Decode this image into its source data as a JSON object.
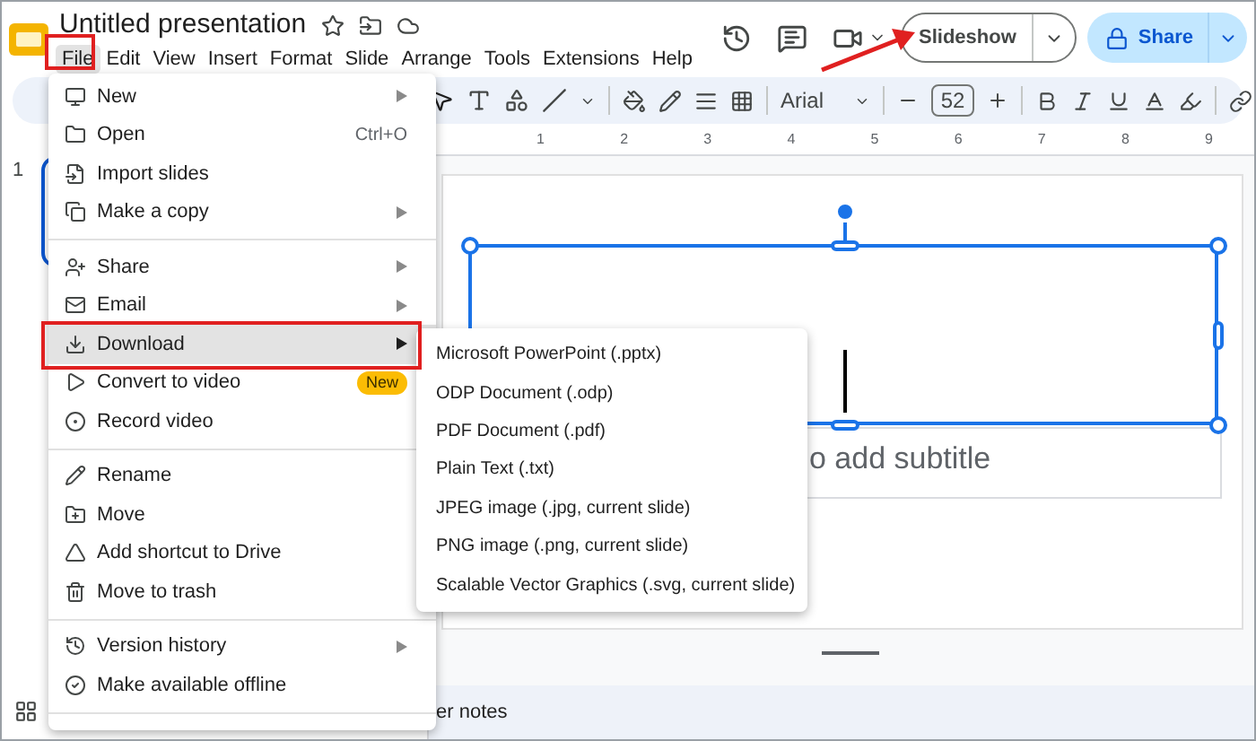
{
  "presentation": {
    "title": "Untitled presentation"
  },
  "menu_bar": [
    {
      "label": "File",
      "selected": true
    },
    {
      "label": "Edit",
      "selected": false
    },
    {
      "label": "View",
      "selected": false
    },
    {
      "label": "Insert",
      "selected": false
    },
    {
      "label": "Format",
      "selected": false
    },
    {
      "label": "Slide",
      "selected": false
    },
    {
      "label": "Arrange",
      "selected": false
    },
    {
      "label": "Tools",
      "selected": false
    },
    {
      "label": "Extensions",
      "selected": false
    },
    {
      "label": "Help",
      "selected": false
    }
  ],
  "header": {
    "slideshow_button": "Slideshow",
    "share_button": "Share"
  },
  "toolbar": {
    "font": "Arial",
    "font_size": "52"
  },
  "ruler": [
    "1",
    "2",
    "3",
    "4",
    "5",
    "6",
    "7",
    "8",
    "9"
  ],
  "filmstrip": {
    "slide_number": "1"
  },
  "slide": {
    "subtitle": "o add subtitle"
  },
  "speaker_notes": "er notes",
  "file_menu": [
    [
      {
        "label": "New",
        "submenu": true,
        "selected": false
      },
      {
        "label": "Open",
        "shortcut": "Ctrl+O",
        "submenu": false,
        "selected": false
      },
      {
        "label": "Import slides",
        "submenu": false,
        "selected": false
      },
      {
        "label": "Make a copy",
        "submenu": true,
        "selected": false
      }
    ],
    [
      {
        "label": "Share",
        "submenu": true,
        "selected": false
      },
      {
        "label": "Email",
        "submenu": true,
        "selected": false
      },
      {
        "label": "Download",
        "submenu": true,
        "selected": true
      },
      {
        "label": "Convert to video",
        "submenu": false,
        "badge": "New",
        "selected": false
      },
      {
        "label": "Record video",
        "submenu": false,
        "selected": false
      }
    ],
    [
      {
        "label": "Rename",
        "submenu": false,
        "selected": false
      },
      {
        "label": "Move",
        "submenu": false,
        "selected": false
      },
      {
        "label": "Add shortcut to Drive",
        "submenu": false,
        "selected": false
      },
      {
        "label": "Move to trash",
        "submenu": false,
        "selected": false
      }
    ],
    [
      {
        "label": "Version history",
        "submenu": true,
        "selected": false
      },
      {
        "label": "Make available offline",
        "submenu": false,
        "selected": false
      }
    ]
  ],
  "download_submenu": [
    "Microsoft PowerPoint (.pptx)",
    "ODP Document (.odp)",
    "PDF Document (.pdf)",
    "Plain Text (.txt)",
    "JPEG image (.jpg, current slide)",
    "PNG image (.png, current slide)",
    "Scalable Vector Graphics (.svg, current slide)"
  ]
}
